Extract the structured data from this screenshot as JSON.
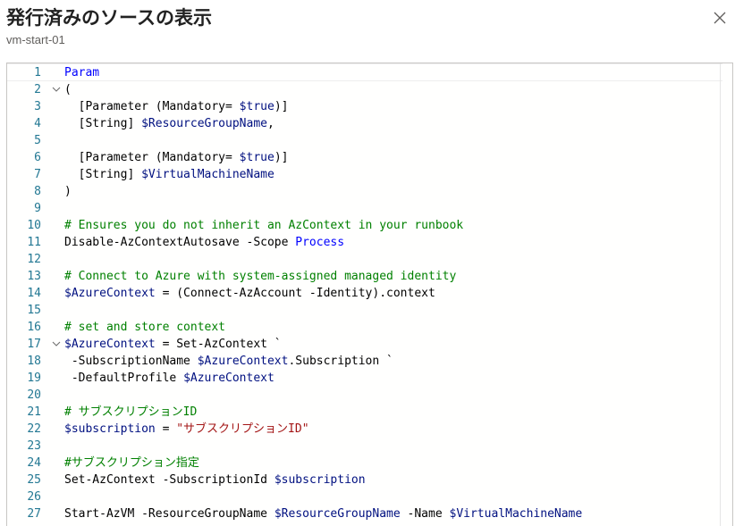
{
  "dialog": {
    "title": "発行済みのソースの表示",
    "subtitle": "vm-start-01",
    "close_icon": "close-icon"
  },
  "editor": {
    "lines": [
      {
        "n": "1",
        "fold": false,
        "tokens": [
          {
            "t": "Param",
            "c": "kw"
          }
        ]
      },
      {
        "n": "2",
        "fold": true,
        "tokens": [
          {
            "t": "(",
            "c": "plain"
          }
        ]
      },
      {
        "n": "3",
        "fold": false,
        "tokens": [
          {
            "t": "  [Parameter (Mandatory= ",
            "c": "plain"
          },
          {
            "t": "$true",
            "c": "var"
          },
          {
            "t": ")]",
            "c": "plain"
          }
        ]
      },
      {
        "n": "4",
        "fold": false,
        "tokens": [
          {
            "t": "  [String] ",
            "c": "plain"
          },
          {
            "t": "$ResourceGroupName",
            "c": "var"
          },
          {
            "t": ",",
            "c": "plain"
          }
        ]
      },
      {
        "n": "5",
        "fold": false,
        "tokens": []
      },
      {
        "n": "6",
        "fold": false,
        "tokens": [
          {
            "t": "  [Parameter (Mandatory= ",
            "c": "plain"
          },
          {
            "t": "$true",
            "c": "var"
          },
          {
            "t": ")]",
            "c": "plain"
          }
        ]
      },
      {
        "n": "7",
        "fold": false,
        "tokens": [
          {
            "t": "  [String] ",
            "c": "plain"
          },
          {
            "t": "$VirtualMachineName",
            "c": "var"
          }
        ]
      },
      {
        "n": "8",
        "fold": false,
        "tokens": [
          {
            "t": ")",
            "c": "plain"
          }
        ]
      },
      {
        "n": "9",
        "fold": false,
        "tokens": []
      },
      {
        "n": "10",
        "fold": false,
        "tokens": [
          {
            "t": "# Ensures you do not inherit an AzContext in your runbook",
            "c": "cmt"
          }
        ]
      },
      {
        "n": "11",
        "fold": false,
        "tokens": [
          {
            "t": "Disable-AzContextAutosave -Scope ",
            "c": "plain"
          },
          {
            "t": "Process",
            "c": "kw"
          }
        ]
      },
      {
        "n": "12",
        "fold": false,
        "tokens": []
      },
      {
        "n": "13",
        "fold": false,
        "tokens": [
          {
            "t": "# Connect to Azure with system-assigned managed identity",
            "c": "cmt"
          }
        ]
      },
      {
        "n": "14",
        "fold": false,
        "tokens": [
          {
            "t": "$AzureContext",
            "c": "var"
          },
          {
            "t": " = (Connect-AzAccount -Identity).context",
            "c": "plain"
          }
        ]
      },
      {
        "n": "15",
        "fold": false,
        "tokens": []
      },
      {
        "n": "16",
        "fold": false,
        "tokens": [
          {
            "t": "# set and store context",
            "c": "cmt"
          }
        ]
      },
      {
        "n": "17",
        "fold": true,
        "tokens": [
          {
            "t": "$AzureContext",
            "c": "var"
          },
          {
            "t": " = Set-AzContext `",
            "c": "plain"
          }
        ]
      },
      {
        "n": "18",
        "fold": false,
        "tokens": [
          {
            "t": " -SubscriptionName ",
            "c": "plain"
          },
          {
            "t": "$AzureContext",
            "c": "var"
          },
          {
            "t": ".Subscription `",
            "c": "plain"
          }
        ]
      },
      {
        "n": "19",
        "fold": false,
        "tokens": [
          {
            "t": " -DefaultProfile ",
            "c": "plain"
          },
          {
            "t": "$AzureContext",
            "c": "var"
          }
        ]
      },
      {
        "n": "20",
        "fold": false,
        "tokens": []
      },
      {
        "n": "21",
        "fold": false,
        "tokens": [
          {
            "t": "# サブスクリプションID",
            "c": "cmt"
          }
        ]
      },
      {
        "n": "22",
        "fold": false,
        "tokens": [
          {
            "t": "$subscription",
            "c": "var"
          },
          {
            "t": " = ",
            "c": "plain"
          },
          {
            "t": "\"サブスクリプションID\"",
            "c": "str"
          }
        ]
      },
      {
        "n": "23",
        "fold": false,
        "tokens": []
      },
      {
        "n": "24",
        "fold": false,
        "tokens": [
          {
            "t": "#サブスクリプション指定",
            "c": "cmt"
          }
        ]
      },
      {
        "n": "25",
        "fold": false,
        "tokens": [
          {
            "t": "Set-AzContext -SubscriptionId ",
            "c": "plain"
          },
          {
            "t": "$subscription",
            "c": "var"
          }
        ]
      },
      {
        "n": "26",
        "fold": false,
        "tokens": []
      },
      {
        "n": "27",
        "fold": false,
        "tokens": [
          {
            "t": "Start-AzVM -ResourceGroupName ",
            "c": "plain"
          },
          {
            "t": "$ResourceGroupName",
            "c": "var"
          },
          {
            "t": " -Name ",
            "c": "plain"
          },
          {
            "t": "$VirtualMachineName",
            "c": "var"
          }
        ]
      }
    ]
  }
}
